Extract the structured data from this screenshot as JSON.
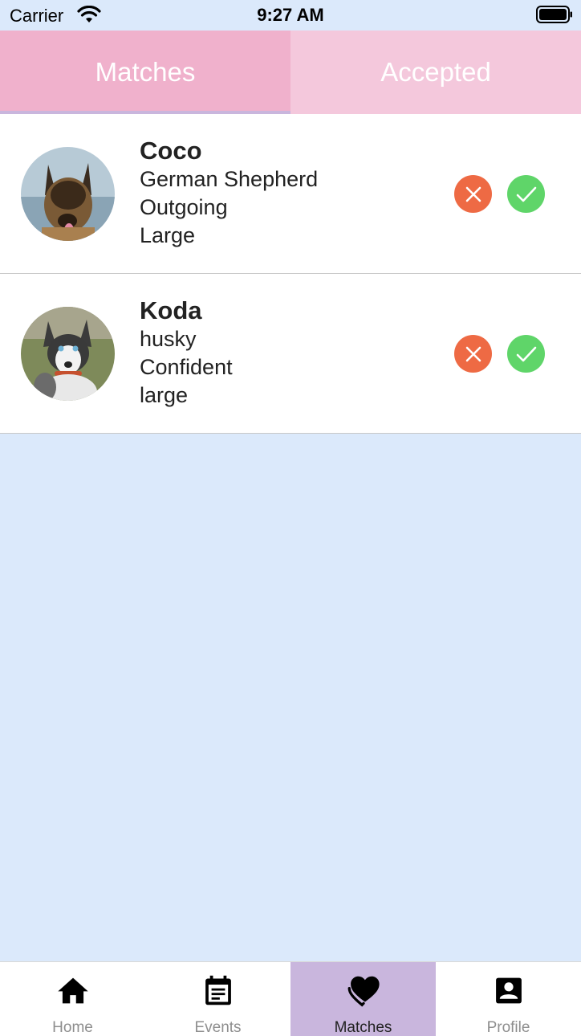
{
  "status_bar": {
    "carrier": "Carrier",
    "time": "9:27 AM"
  },
  "tabs": [
    {
      "label": "Matches",
      "active": true
    },
    {
      "label": "Accepted",
      "active": false
    }
  ],
  "matches": [
    {
      "name": "Coco",
      "breed": "German Shepherd",
      "temperament": "Outgoing",
      "size": "Large",
      "photo_icon": "german-shepherd-photo"
    },
    {
      "name": "Koda",
      "breed": "husky",
      "temperament": "Confident",
      "size": "large",
      "photo_icon": "husky-photo"
    }
  ],
  "actions": {
    "reject_icon": "x-icon",
    "accept_icon": "check-icon"
  },
  "colors": {
    "background": "#dbe9fb",
    "tab_active": "#f0b1cc",
    "tab_inactive": "#f4c8dc",
    "reject": "#ee6a44",
    "accept": "#5fd569",
    "nav_active": "#c9b6dd"
  },
  "bottom_nav": [
    {
      "label": "Home",
      "icon": "home-icon",
      "active": false
    },
    {
      "label": "Events",
      "icon": "calendar-icon",
      "active": false
    },
    {
      "label": "Matches",
      "icon": "heart-icon",
      "active": true
    },
    {
      "label": "Profile",
      "icon": "profile-icon",
      "active": false
    }
  ]
}
